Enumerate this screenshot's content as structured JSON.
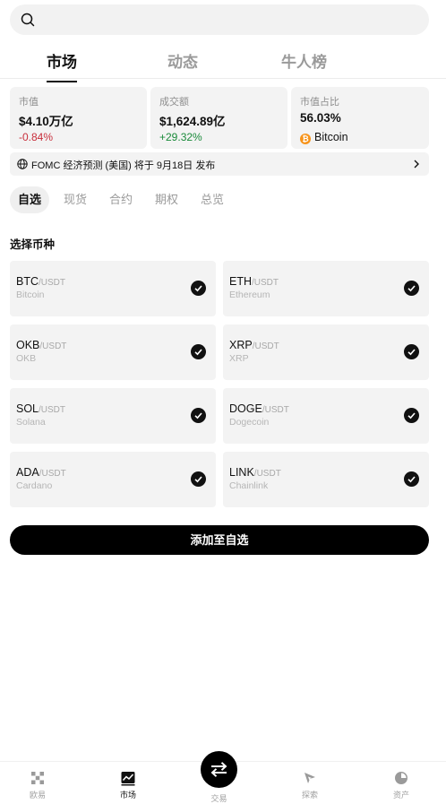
{
  "search": {
    "placeholder": ""
  },
  "top_tabs": [
    {
      "label": "市场",
      "active": true
    },
    {
      "label": "动态",
      "active": false
    },
    {
      "label": "牛人榜",
      "active": false
    }
  ],
  "stats": {
    "market_cap": {
      "label": "市值",
      "value": "$4.10万亿",
      "change": "-0.84%"
    },
    "volume": {
      "label": "成交额",
      "value": "$1,624.89亿",
      "change": "+29.32%"
    },
    "dominance": {
      "label": "市值占比",
      "value": "56.03%",
      "coin": "Bitcoin",
      "coin_badge": "₿"
    }
  },
  "notice": {
    "text": "FOMC 经济预测 (美国) 将于 9月18日 发布"
  },
  "sub_tabs": [
    {
      "label": "自选",
      "active": true
    },
    {
      "label": "现货",
      "active": false
    },
    {
      "label": "合约",
      "active": false
    },
    {
      "label": "期权",
      "active": false
    },
    {
      "label": "总览",
      "active": false
    }
  ],
  "section_title": "选择币种",
  "coins": [
    {
      "symbol": "BTC",
      "pair": "/USDT",
      "name": "Bitcoin",
      "selected": true
    },
    {
      "symbol": "ETH",
      "pair": "/USDT",
      "name": "Ethereum",
      "selected": true
    },
    {
      "symbol": "OKB",
      "pair": "/USDT",
      "name": "OKB",
      "selected": true
    },
    {
      "symbol": "XRP",
      "pair": "/USDT",
      "name": "XRP",
      "selected": true
    },
    {
      "symbol": "SOL",
      "pair": "/USDT",
      "name": "Solana",
      "selected": true
    },
    {
      "symbol": "DOGE",
      "pair": "/USDT",
      "name": "Dogecoin",
      "selected": true
    },
    {
      "symbol": "ADA",
      "pair": "/USDT",
      "name": "Cardano",
      "selected": true
    },
    {
      "symbol": "LINK",
      "pair": "/USDT",
      "name": "Chainlink",
      "selected": true
    }
  ],
  "add_button": "添加至自选",
  "bottom_nav": [
    {
      "label": "欧易",
      "icon": "okx-logo-icon",
      "active": false
    },
    {
      "label": "市场",
      "icon": "chart-icon",
      "active": true
    },
    {
      "label": "交易",
      "icon": "swap-arrows-icon",
      "active": false
    },
    {
      "label": "探索",
      "icon": "compass-icon",
      "active": false
    },
    {
      "label": "资产",
      "icon": "pie-chart-icon",
      "active": false
    }
  ],
  "colors": {
    "negative": "#c82f3c",
    "positive": "#1a8a3a",
    "btc_orange": "#f7931a"
  }
}
